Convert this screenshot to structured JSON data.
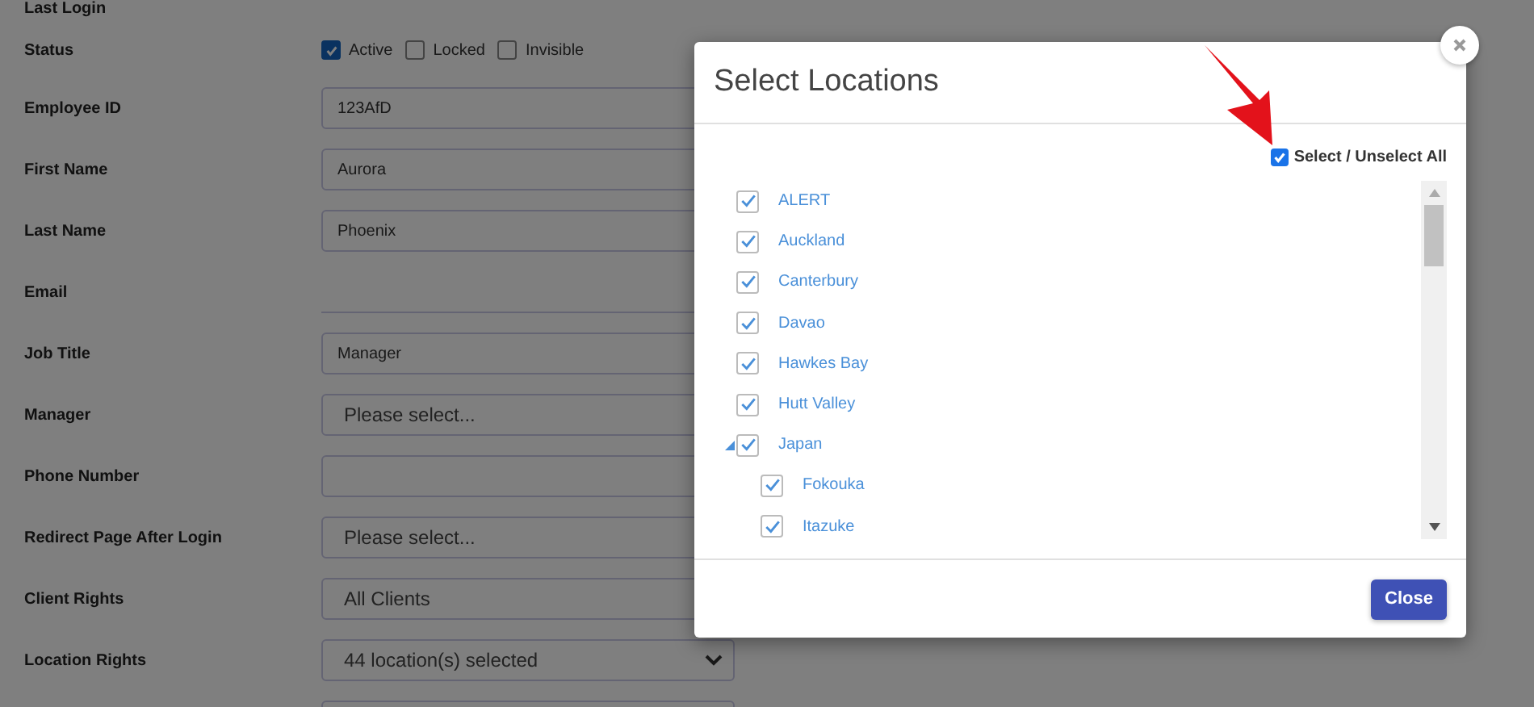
{
  "form": {
    "cut_label": "Last Login",
    "status": {
      "label": "Status",
      "options": [
        {
          "label": "Active",
          "checked": true
        },
        {
          "label": "Locked",
          "checked": false
        },
        {
          "label": "Invisible",
          "checked": false
        }
      ]
    },
    "fields": [
      {
        "label": "Employee ID",
        "kind": "input",
        "value": "123AfD"
      },
      {
        "label": "First Name",
        "kind": "input",
        "value": "Aurora"
      },
      {
        "label": "Last Name",
        "kind": "input",
        "value": "Phoenix"
      },
      {
        "label": "Email",
        "kind": "line"
      },
      {
        "label": "Job Title",
        "kind": "input",
        "value": "Manager"
      },
      {
        "label": "Manager",
        "kind": "select",
        "placeholder": "Please select..."
      },
      {
        "label": "Phone Number",
        "kind": "input"
      },
      {
        "label": "Redirect Page After Login",
        "kind": "select",
        "placeholder": "Please select..."
      },
      {
        "label": "Client Rights",
        "kind": "select",
        "value": "All Clients"
      },
      {
        "label": "Location Rights",
        "kind": "dropdown",
        "value": "44 location(s) selected"
      }
    ]
  },
  "dialog": {
    "title": "Select Locations",
    "select_all": {
      "label": "Select / Unselect All",
      "checked": true
    },
    "locations": [
      {
        "label": "ALERT",
        "checked": true
      },
      {
        "label": "Auckland",
        "checked": true
      },
      {
        "label": "Canterbury",
        "checked": true
      },
      {
        "label": "Davao",
        "checked": true
      },
      {
        "label": "Hawkes Bay",
        "checked": true
      },
      {
        "label": "Hutt Valley",
        "checked": true
      },
      {
        "label": "Japan",
        "checked": true,
        "expanded": true,
        "children": [
          {
            "label": "Fokouka",
            "checked": true
          },
          {
            "label": "Itazuke",
            "checked": true
          }
        ]
      }
    ],
    "close_button": "Close"
  }
}
